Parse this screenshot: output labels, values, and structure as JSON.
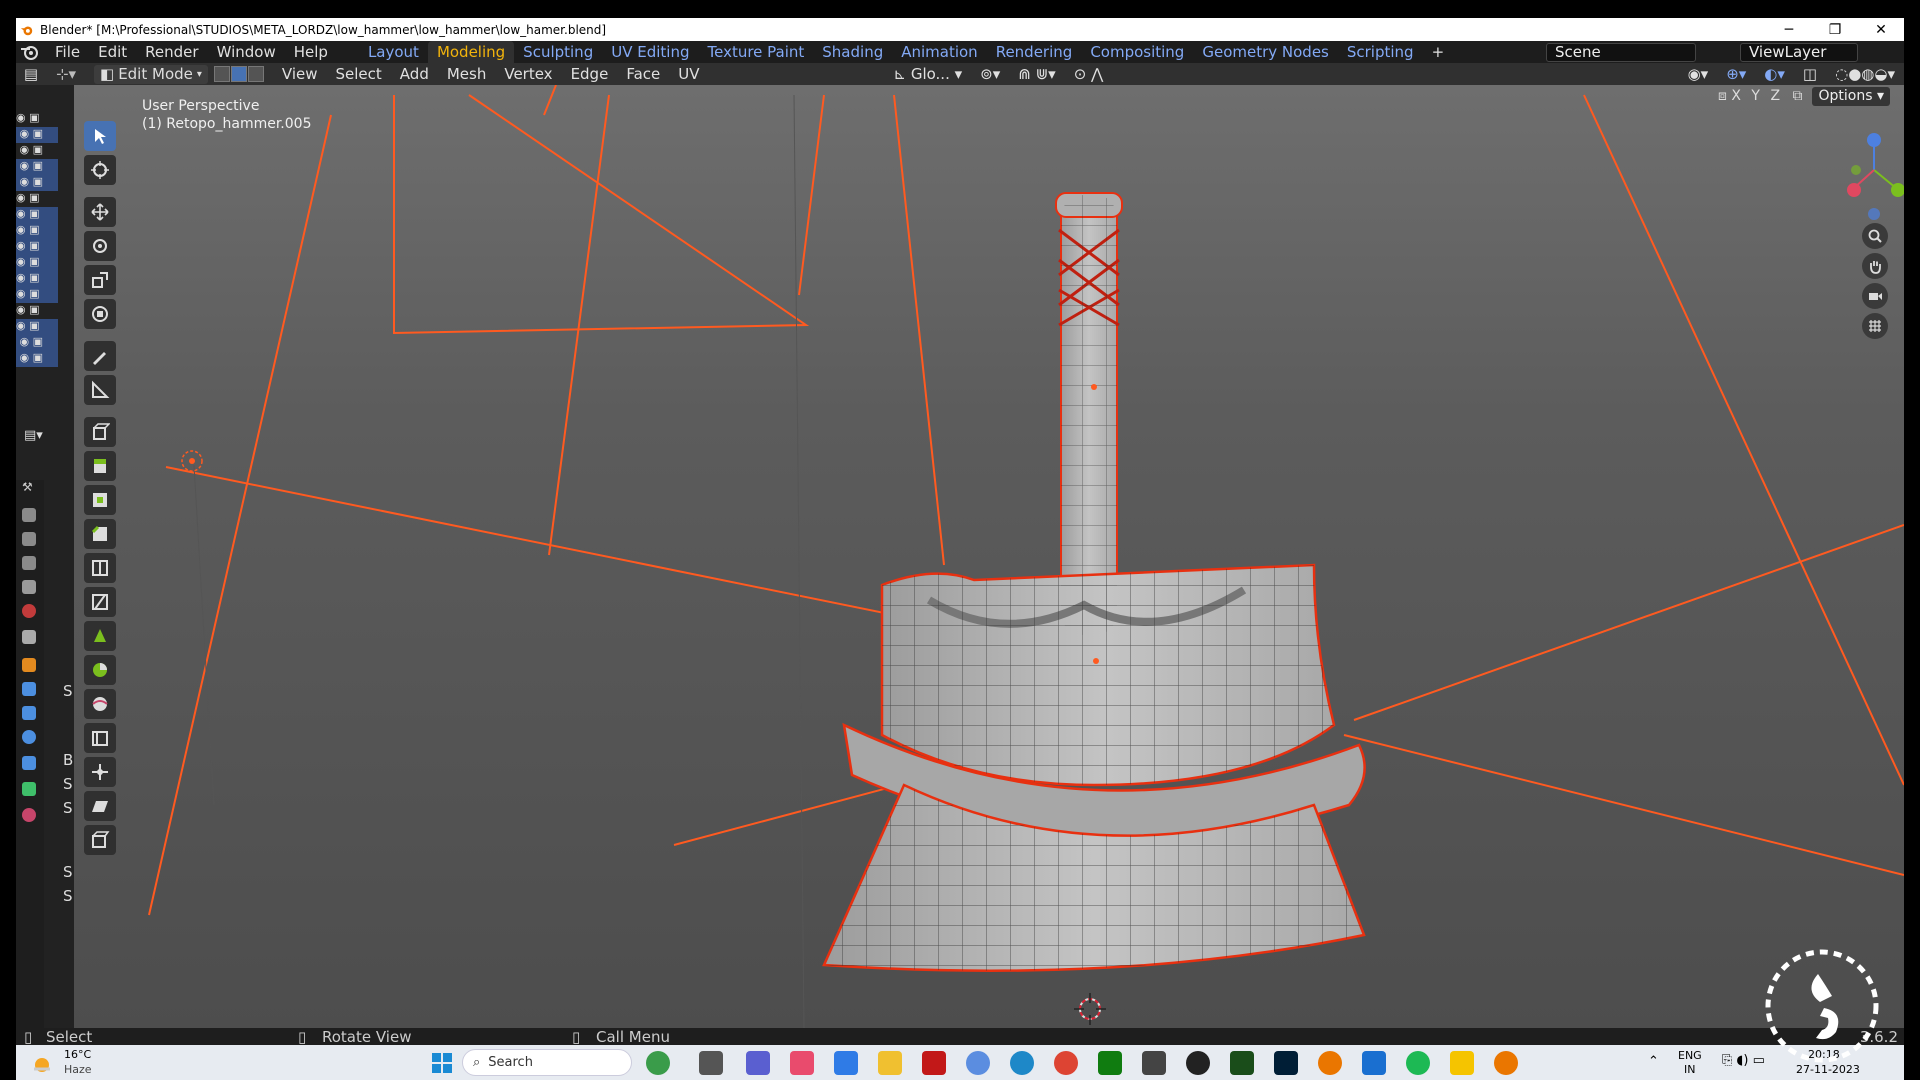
{
  "window": {
    "title": "Blender* [M:\\Professional\\STUDIOS\\META_LORDZ\\low_hammer\\low_hammer\\low_hamer.blend]",
    "minimize": "─",
    "maximize": "❐",
    "close": "✕"
  },
  "menu": [
    "File",
    "Edit",
    "Render",
    "Window",
    "Help"
  ],
  "workspaces": {
    "tabs": [
      "Layout",
      "Modeling",
      "Sculpting",
      "UV Editing",
      "Texture Paint",
      "Shading",
      "Animation",
      "Rendering",
      "Compositing",
      "Geometry Nodes",
      "Scripting"
    ],
    "active": "Modeling",
    "add": "+"
  },
  "scene": {
    "name": "Scene",
    "view_layer": "ViewLayer"
  },
  "header": {
    "mode": "Edit Mode",
    "menus": [
      "View",
      "Select",
      "Add",
      "Mesh",
      "Vertex",
      "Edge",
      "Face",
      "UV"
    ],
    "transform_orientation": "Glo..."
  },
  "viewport": {
    "view_name": "User Perspective",
    "object_name": "(1) Retopo_hammer.005",
    "axis_labels": [
      "X",
      "Y",
      "Z"
    ],
    "options_label": "Options"
  },
  "properties_letters": [
    "S",
    "B",
    "S",
    "S",
    "S",
    "S"
  ],
  "status": {
    "left": "Select",
    "middle": "Rotate View",
    "right": "Call Menu",
    "version": "3.6.2"
  },
  "taskbar": {
    "weather_temp": "16°C",
    "weather_desc": "Haze",
    "search_placeholder": "Search",
    "lang": "ENG",
    "region": "IN",
    "date": "27-11-2023",
    "time": "20:18"
  },
  "colors": {
    "accent": "#4772b3",
    "active_workspace": "#f2b40c",
    "workspace_link": "#83a9f5",
    "selection_edge": "#e83010",
    "wire": "#ff5a20"
  },
  "icons": {
    "logo": "blender-logo-icon",
    "weather": "weather-sun-icon",
    "windows": "windows-start-icon"
  }
}
